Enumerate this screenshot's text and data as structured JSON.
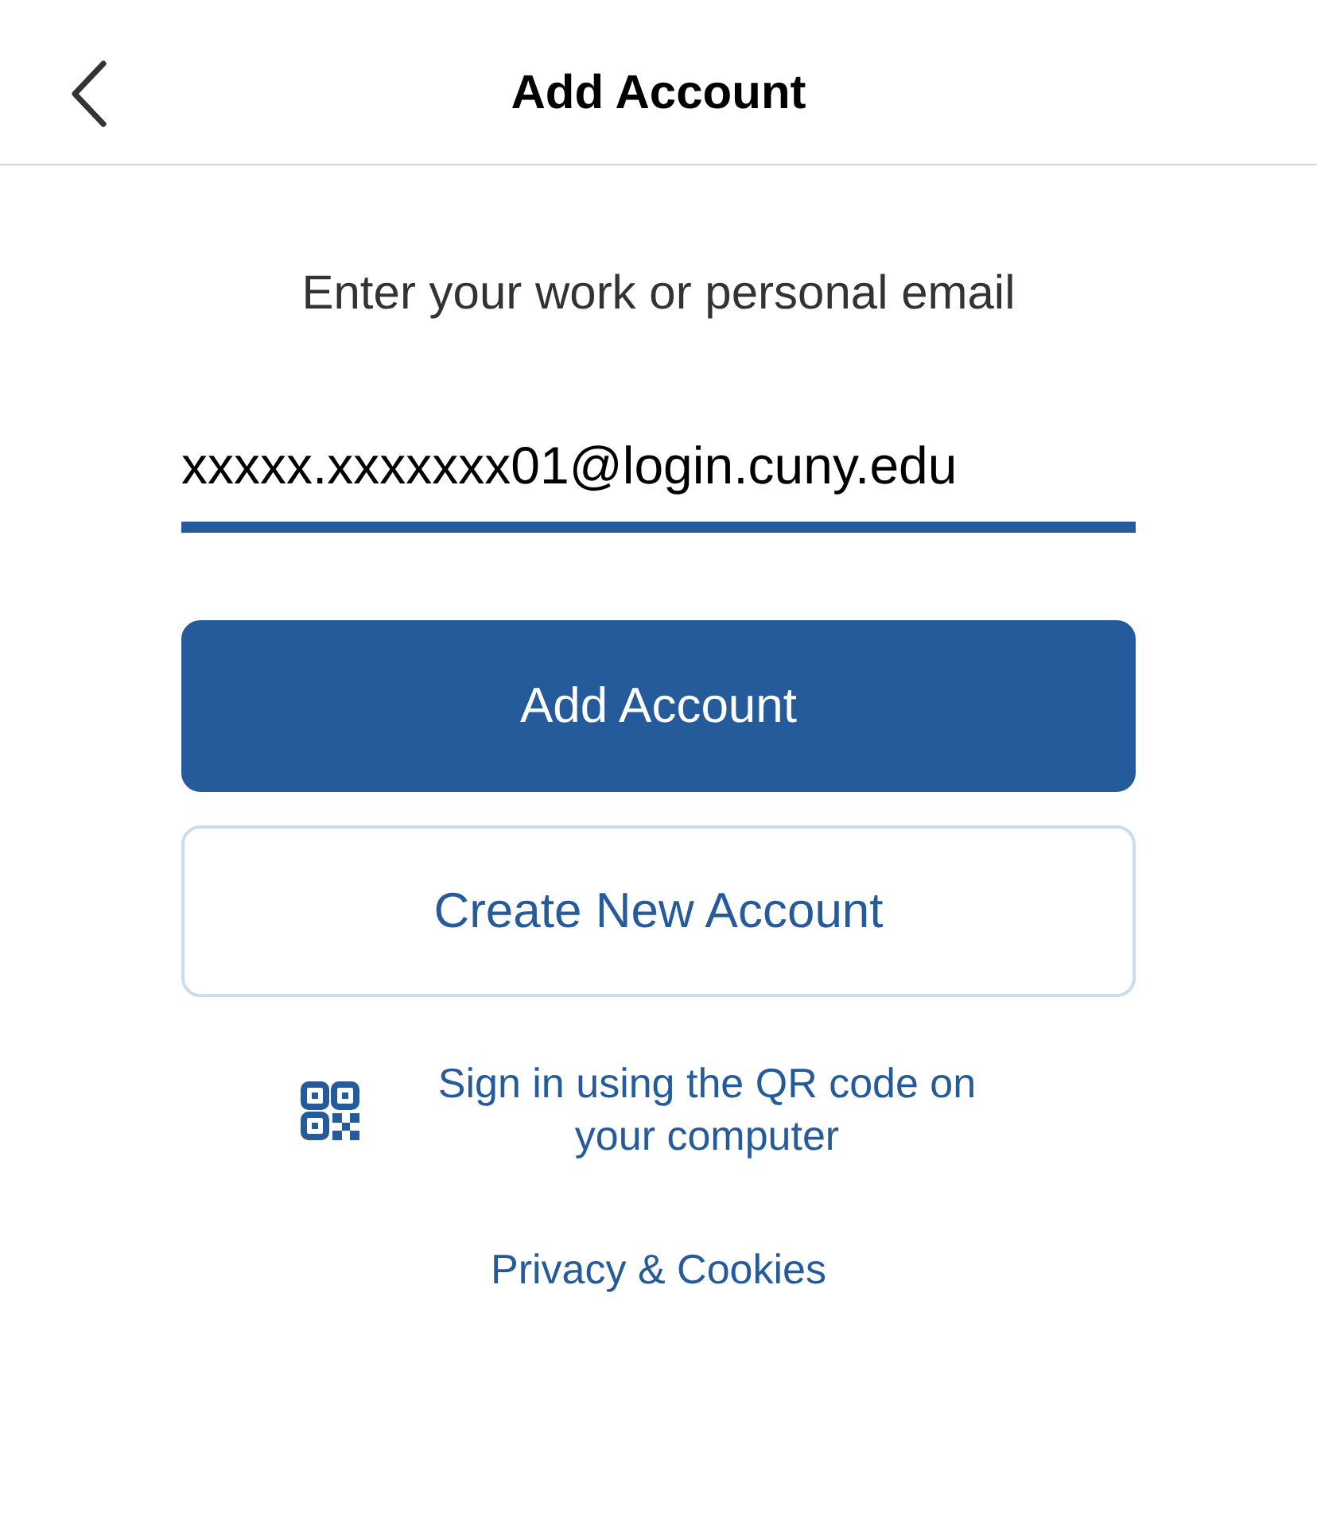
{
  "header": {
    "title": "Add Account"
  },
  "prompt": "Enter your work or personal email",
  "email_field": {
    "value": "xxxxx.xxxxxxx01@login.cuny.edu",
    "focused": true
  },
  "buttons": [
    {
      "label": "Add Account",
      "kind": "primary"
    },
    {
      "label": "Create New Account",
      "kind": "secondary"
    }
  ],
  "qr_link": "Sign in using the QR code on your computer",
  "privacy_link": "Privacy & Cookies"
}
